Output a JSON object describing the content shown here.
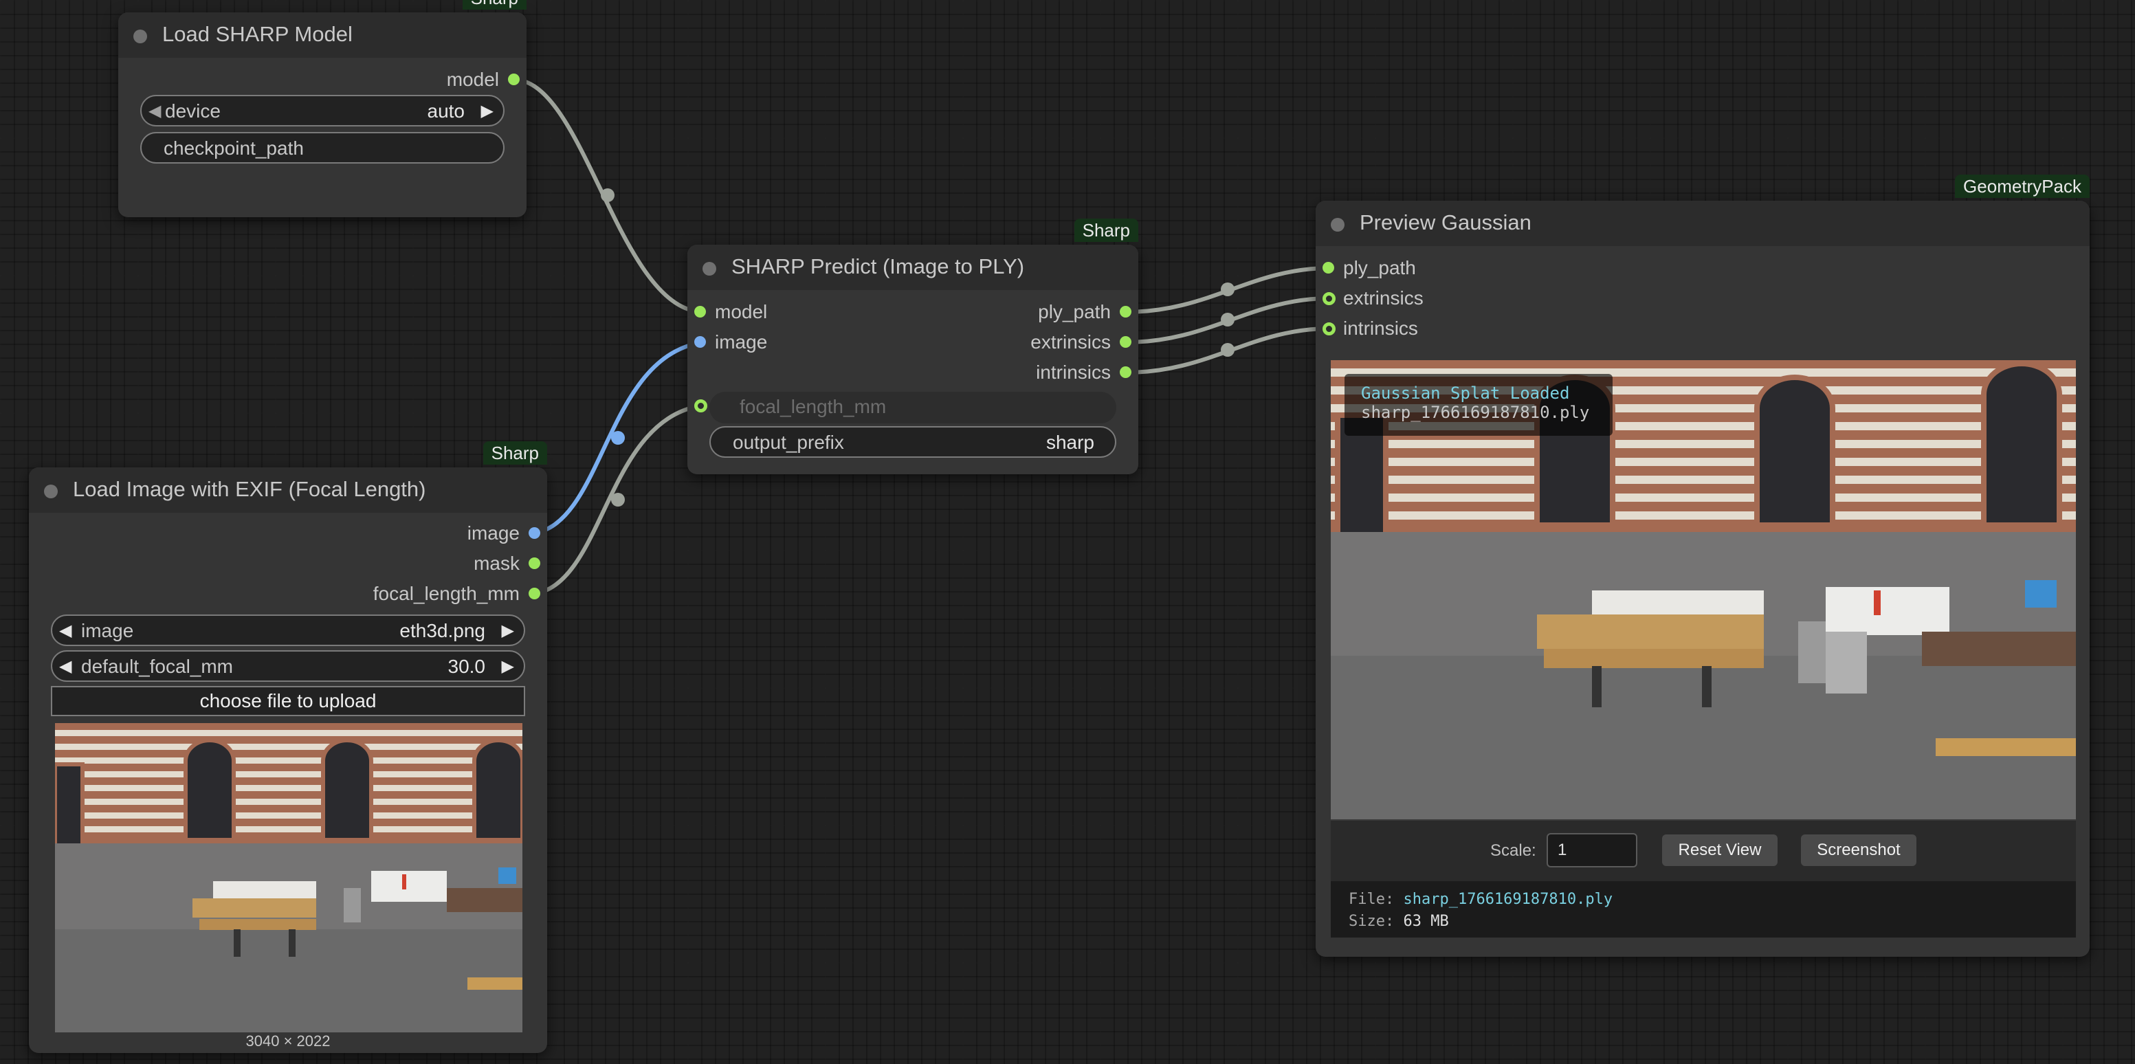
{
  "canvas_colors": {
    "background": "#212121",
    "wire_default": "#9ea39b",
    "wire_image": "#7aaef0",
    "slot_green": "#9be65a",
    "slot_blue": "#7aaef0",
    "badge_bg": "#153319"
  },
  "nodes": {
    "load_model": {
      "badge": "Sharp",
      "title": "Load SHARP Model",
      "outputs": [
        {
          "label": "model",
          "color": "green"
        }
      ],
      "widgets": {
        "device": {
          "name": "device",
          "value": "auto"
        },
        "checkpoint_path": {
          "name": "checkpoint_path",
          "value": ""
        }
      }
    },
    "predict": {
      "badge": "Sharp",
      "title": "SHARP Predict (Image to PLY)",
      "inputs": [
        {
          "label": "model",
          "color": "green"
        },
        {
          "label": "image",
          "color": "blue"
        }
      ],
      "outputs": [
        {
          "label": "ply_path"
        },
        {
          "label": "extrinsics"
        },
        {
          "label": "intrinsics"
        }
      ],
      "widgets": {
        "focal_length_mm": {
          "name": "focal_length_mm",
          "value": ""
        },
        "output_prefix": {
          "name": "output_prefix",
          "value": "sharp"
        }
      }
    },
    "load_image": {
      "badge": "Sharp",
      "title": "Load Image with EXIF (Focal Length)",
      "outputs": [
        {
          "label": "image",
          "color": "blue"
        },
        {
          "label": "mask",
          "color": "green"
        },
        {
          "label": "focal_length_mm",
          "color": "green"
        }
      ],
      "widgets": {
        "image": {
          "name": "image",
          "value": "eth3d.png"
        },
        "default_focal_mm": {
          "name": "default_focal_mm",
          "value": "30.0"
        }
      },
      "upload_label": "choose file to upload",
      "image_size": "3040 × 2022"
    },
    "preview": {
      "badge": "GeometryPack",
      "title": "Preview Gaussian",
      "inputs": [
        {
          "label": "ply_path"
        },
        {
          "label": "extrinsics"
        },
        {
          "label": "intrinsics"
        }
      ],
      "overlay": {
        "status": "Gaussian Splat Loaded",
        "filename": "sharp_1766169187810.ply"
      },
      "toolbar": {
        "scale_label": "Scale:",
        "scale_value": "1",
        "reset_label": "Reset View",
        "screenshot_label": "Screenshot"
      },
      "info": {
        "file_key": "File:",
        "file_value": "sharp_1766169187810.ply",
        "size_key": "Size:",
        "size_value": "63 MB"
      }
    }
  }
}
